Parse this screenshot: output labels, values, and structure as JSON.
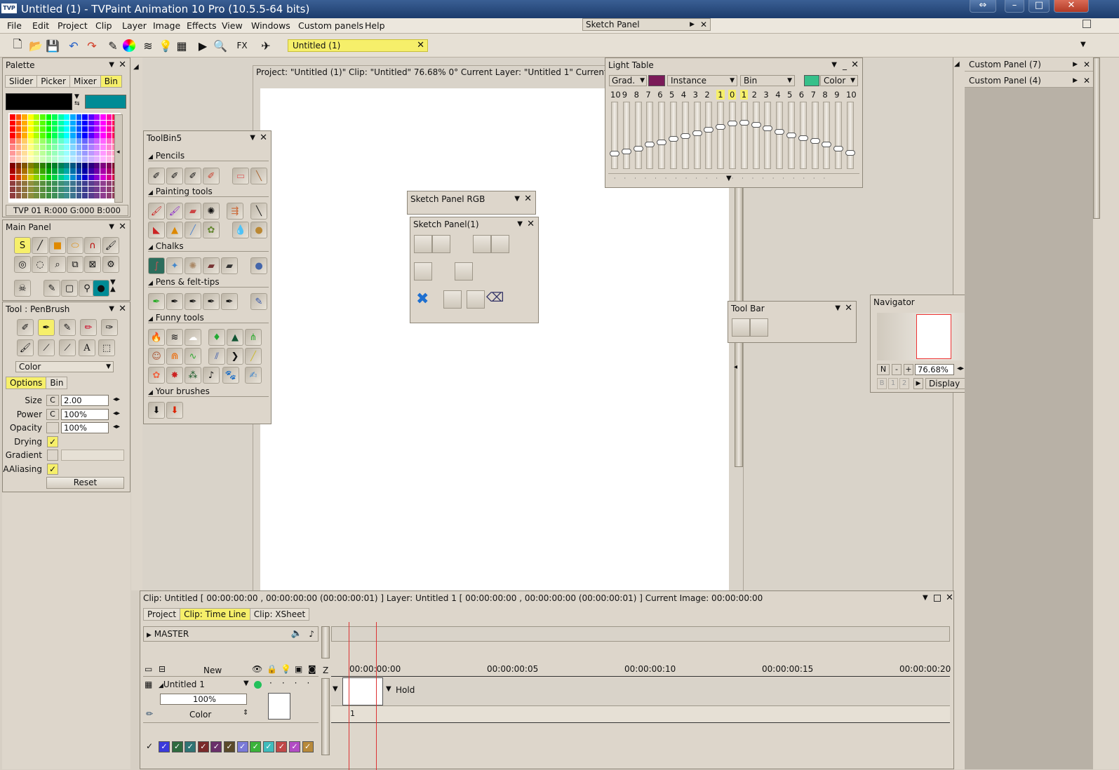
{
  "window": {
    "title": "Untitled (1) - TVPaint Animation 10 Pro (10.5.5-64 bits)",
    "logo": "TVP"
  },
  "menu": [
    "File",
    "Edit",
    "Project",
    "Clip",
    "Layer",
    "Image",
    "Effects",
    "View",
    "Windows",
    "Custom panels",
    "Help"
  ],
  "floating_sketch_panel": "Sketch Panel",
  "toolbar": {
    "doc_tab": "Untitled (1)",
    "fx_label": "FX"
  },
  "palette": {
    "title": "Palette",
    "tabs": [
      "Slider",
      "Picker",
      "Mixer",
      "Bin"
    ],
    "active_tab": "Bin",
    "status": "TVP 01 R:000 G:000 B:000",
    "primary_color": "#000000",
    "secondary_color": "#008b95"
  },
  "main_panel": {
    "title": "Main Panel"
  },
  "tool_panel": {
    "title": "Tool : PenBrush",
    "mode": "Color",
    "tabs": [
      "Options",
      "Bin"
    ],
    "size_label": "Size",
    "size_value": "2.00",
    "power_label": "Power",
    "power_value": "100%",
    "opacity_label": "Opacity",
    "opacity_value": "100%",
    "drying_label": "Drying",
    "gradient_label": "Gradient",
    "aaliasing_label": "AAliasing",
    "reset_label": "Reset",
    "c_label": "C"
  },
  "toolbin": {
    "title": "ToolBin5",
    "sections": [
      "Pencils",
      "Painting tools",
      "Chalks",
      "Pens & felt-tips",
      "Funny tools",
      "Your brushes"
    ]
  },
  "project_bar": "Project: \"Untitled (1)\" Clip: \"Untitled\" 76.68% 0° Current Layer: \"Untitled 1\" Current Image",
  "sketch_rgb": {
    "title": "Sketch Panel RGB"
  },
  "sketch_1": {
    "title": "Sketch Panel(1)"
  },
  "light_table": {
    "title": "Light Table",
    "grad_label": "Grad.",
    "instance_label": "Instance",
    "bin_label": "Bin",
    "color_label": "Color",
    "numbers": [
      "10",
      "9",
      "8",
      "7",
      "6",
      "5",
      "4",
      "3",
      "2",
      "1",
      "0",
      "1",
      "2",
      "3",
      "4",
      "5",
      "6",
      "7",
      "8",
      "9",
      "10"
    ],
    "knob_levels": [
      0.22,
      0.25,
      0.3,
      0.36,
      0.4,
      0.45,
      0.5,
      0.55,
      0.6,
      0.65,
      0.7,
      0.72,
      0.68,
      0.62,
      0.57,
      0.51,
      0.47,
      0.42,
      0.36,
      0.3,
      0.23
    ],
    "accent_color": "#7a1a58",
    "color_swatch": "#36c08a"
  },
  "tool_bar_panel": {
    "title": "Tool Bar"
  },
  "navigator": {
    "title": "Navigator",
    "n_label": "N",
    "minus": "-",
    "plus": "+",
    "zoom": "76.68%",
    "one": "1",
    "f": "F",
    "b_label": "B",
    "b1": "1",
    "b2": "2",
    "display_label": "Display"
  },
  "custom_panels": [
    "Custom Panel (7)",
    "Custom Panel (4)"
  ],
  "timeline": {
    "info": "Clip: Untitled [ 00:00:00:00 , 00:00:00:00  (00:00:00:01) ]     Layer: Untitled 1 [ 00:00:00:00 , 00:00:00:00  (00:00:00:01) ]    Current Image: 00:00:00:00",
    "tabs": [
      "Project",
      "Clip: Time Line",
      "Clip: XSheet"
    ],
    "active_tab": "Clip: Time Line",
    "master_label": "MASTER",
    "new_label": "New",
    "z_label": "Z",
    "layer_name": "Untitled 1",
    "layer_opacity": "100%",
    "layer_mode": "Color",
    "hold_label": "Hold",
    "frame_number": "1",
    "ruler": [
      "00:00:00:00",
      "00:00:00:05",
      "00:00:00:10",
      "00:00:00:15",
      "00:00:00:20"
    ],
    "color_tags": [
      "#3b3bdc",
      "#2e6b3f",
      "#2f7474",
      "#7a2a2a",
      "#6a2f6a",
      "#5a4a2a",
      "#7a7ad8",
      "#3bb33b",
      "#3fbcbc",
      "#c04747",
      "#b24cc4",
      "#b88a3b"
    ]
  }
}
